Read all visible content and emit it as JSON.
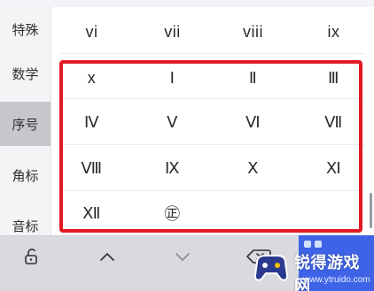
{
  "sidebar": {
    "items": [
      {
        "label": "特殊",
        "active": false
      },
      {
        "label": "数学",
        "active": false
      },
      {
        "label": "序号",
        "active": true
      },
      {
        "label": "角标",
        "active": false
      },
      {
        "label": "音标",
        "active": false
      }
    ]
  },
  "grid": {
    "rows": [
      [
        "vi",
        "vii",
        "viii",
        "ix"
      ],
      [
        "x",
        "Ⅰ",
        "Ⅱ",
        "Ⅲ"
      ],
      [
        "Ⅳ",
        "Ⅴ",
        "Ⅵ",
        "Ⅶ"
      ],
      [
        "Ⅷ",
        "Ⅸ",
        "Ⅹ",
        "Ⅺ"
      ],
      [
        "Ⅻ",
        "㊣",
        "",
        ""
      ]
    ]
  },
  "toolbar": {
    "icons": [
      "unlock-icon",
      "chevron-up-icon",
      "chevron-down-icon",
      "backspace-icon"
    ]
  },
  "watermark": {
    "title": "锐得游戏网",
    "url": "www.ytruido.com"
  },
  "colors": {
    "highlight": "#e11a24",
    "active_tab": "#c6c6cc",
    "brand_blue": "#3f63e6"
  }
}
